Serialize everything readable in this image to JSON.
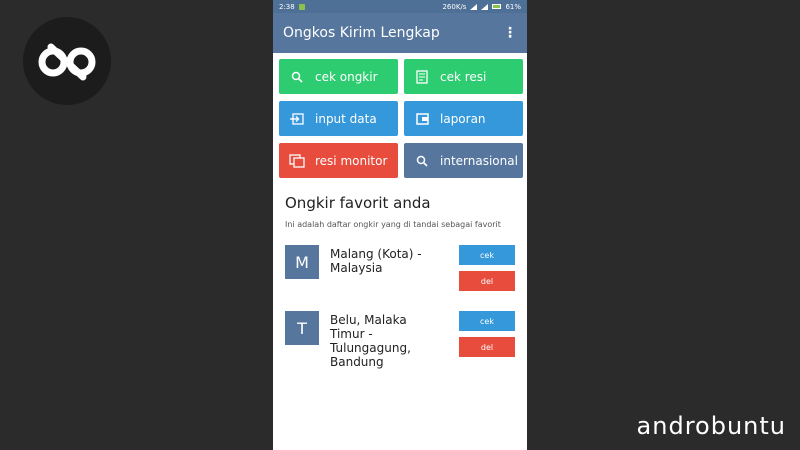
{
  "status_bar": {
    "time": "2:38",
    "speed": "260K/s",
    "battery": "61%"
  },
  "app": {
    "title": "Ongkos Kirim Lengkap",
    "menu_glyph": "⋮"
  },
  "tiles": [
    {
      "label": "cek ongkir",
      "color": "#2ecc71"
    },
    {
      "label": "cek resi",
      "color": "#2ecc71"
    },
    {
      "label": "input data",
      "color": "#3498db"
    },
    {
      "label": "laporan",
      "color": "#3498db"
    },
    {
      "label": "resi monitor",
      "color": "#e74c3c"
    },
    {
      "label": "internasional",
      "color": "#56769e"
    }
  ],
  "favorites": {
    "title": "Ongkir favorit anda",
    "subtitle": "Ini adalah daftar ongkir yang di tandai sebagai favorit",
    "items": [
      {
        "initial": "M",
        "name": "Malang (Kota) - Malaysia",
        "cek_label": "cek",
        "del_label": "del"
      },
      {
        "initial": "T",
        "name": "Belu, Malaka Timur - Tulungagung, Bandung",
        "cek_label": "cek",
        "del_label": "del"
      }
    ]
  },
  "watermark": {
    "text": "androbuntu"
  },
  "colors": {
    "primary": "#56769e",
    "green": "#2ecc71",
    "blue": "#3498db",
    "red": "#e74c3c"
  }
}
